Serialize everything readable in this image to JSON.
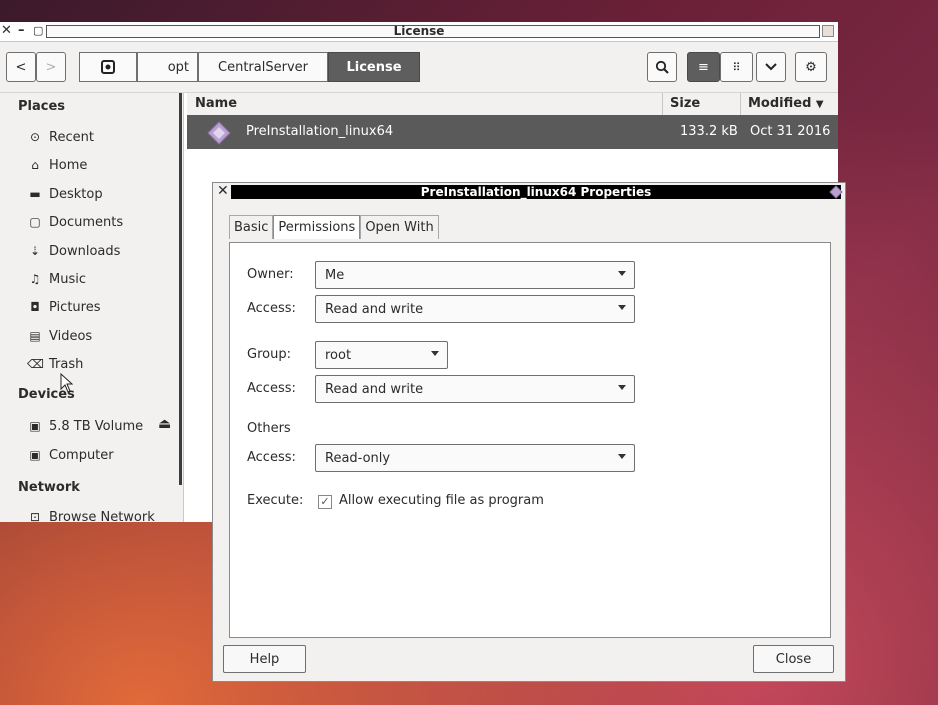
{
  "window": {
    "title": "License",
    "close_glyph": "✕",
    "min_glyph": "–",
    "max_glyph": "▢"
  },
  "toolbar": {
    "back_glyph": "<",
    "forward_glyph": ">",
    "breadcrumbs": [
      "opt",
      "CentralServer",
      "License"
    ],
    "search_glyph": "🔍",
    "list_view_glyph": "≡",
    "grid_view_glyph": "⠿",
    "dropdown_glyph": "⌄",
    "settings_glyph": "⚙"
  },
  "sidebar": {
    "places_header": "Places",
    "places": [
      {
        "icon": "clock-icon",
        "glyph": "⊙",
        "label": "Recent"
      },
      {
        "icon": "home-icon",
        "glyph": "⌂",
        "label": "Home"
      },
      {
        "icon": "folder-icon",
        "glyph": "▬",
        "label": "Desktop"
      },
      {
        "icon": "document-icon",
        "glyph": "▢",
        "label": "Documents"
      },
      {
        "icon": "download-icon",
        "glyph": "⇣",
        "label": "Downloads"
      },
      {
        "icon": "music-icon",
        "glyph": "♫",
        "label": "Music"
      },
      {
        "icon": "camera-icon",
        "glyph": "◘",
        "label": "Pictures"
      },
      {
        "icon": "film-icon",
        "glyph": "▤",
        "label": "Videos"
      },
      {
        "icon": "trash-icon",
        "glyph": "⌫",
        "label": "Trash"
      }
    ],
    "devices_header": "Devices",
    "devices": [
      {
        "icon": "drive-icon",
        "glyph": "▣",
        "label": "5.8 TB Volume"
      },
      {
        "icon": "drive-icon",
        "glyph": "▣",
        "label": "Computer"
      }
    ],
    "eject_glyph": "⏏",
    "network_header": "Network",
    "network": [
      {
        "icon": "network-icon",
        "glyph": "⊡",
        "label": "Browse Network"
      }
    ]
  },
  "list": {
    "col_name": "Name",
    "col_size": "Size",
    "col_modified": "Modified",
    "rows": [
      {
        "name": "PreInstallation_linux64",
        "size": "133.2 kB",
        "modified": "Oct 31 2016"
      }
    ]
  },
  "dialog": {
    "title": "PreInstallation_linux64 Properties",
    "tabs": [
      "Basic",
      "Permissions",
      "Open With"
    ],
    "active_tab": "Permissions",
    "owner_label": "Owner:",
    "owner_value": "Me",
    "owner_access_label": "Access:",
    "owner_access_value": "Read and write",
    "group_label": "Group:",
    "group_value": "root",
    "group_access_label": "Access:",
    "group_access_value": "Read and write",
    "others_label": "Others",
    "others_access_label": "Access:",
    "others_access_value": "Read-only",
    "execute_label": "Execute:",
    "execute_checked": true,
    "execute_option": "Allow executing file as program",
    "help_label": "Help",
    "close_label": "Close"
  }
}
